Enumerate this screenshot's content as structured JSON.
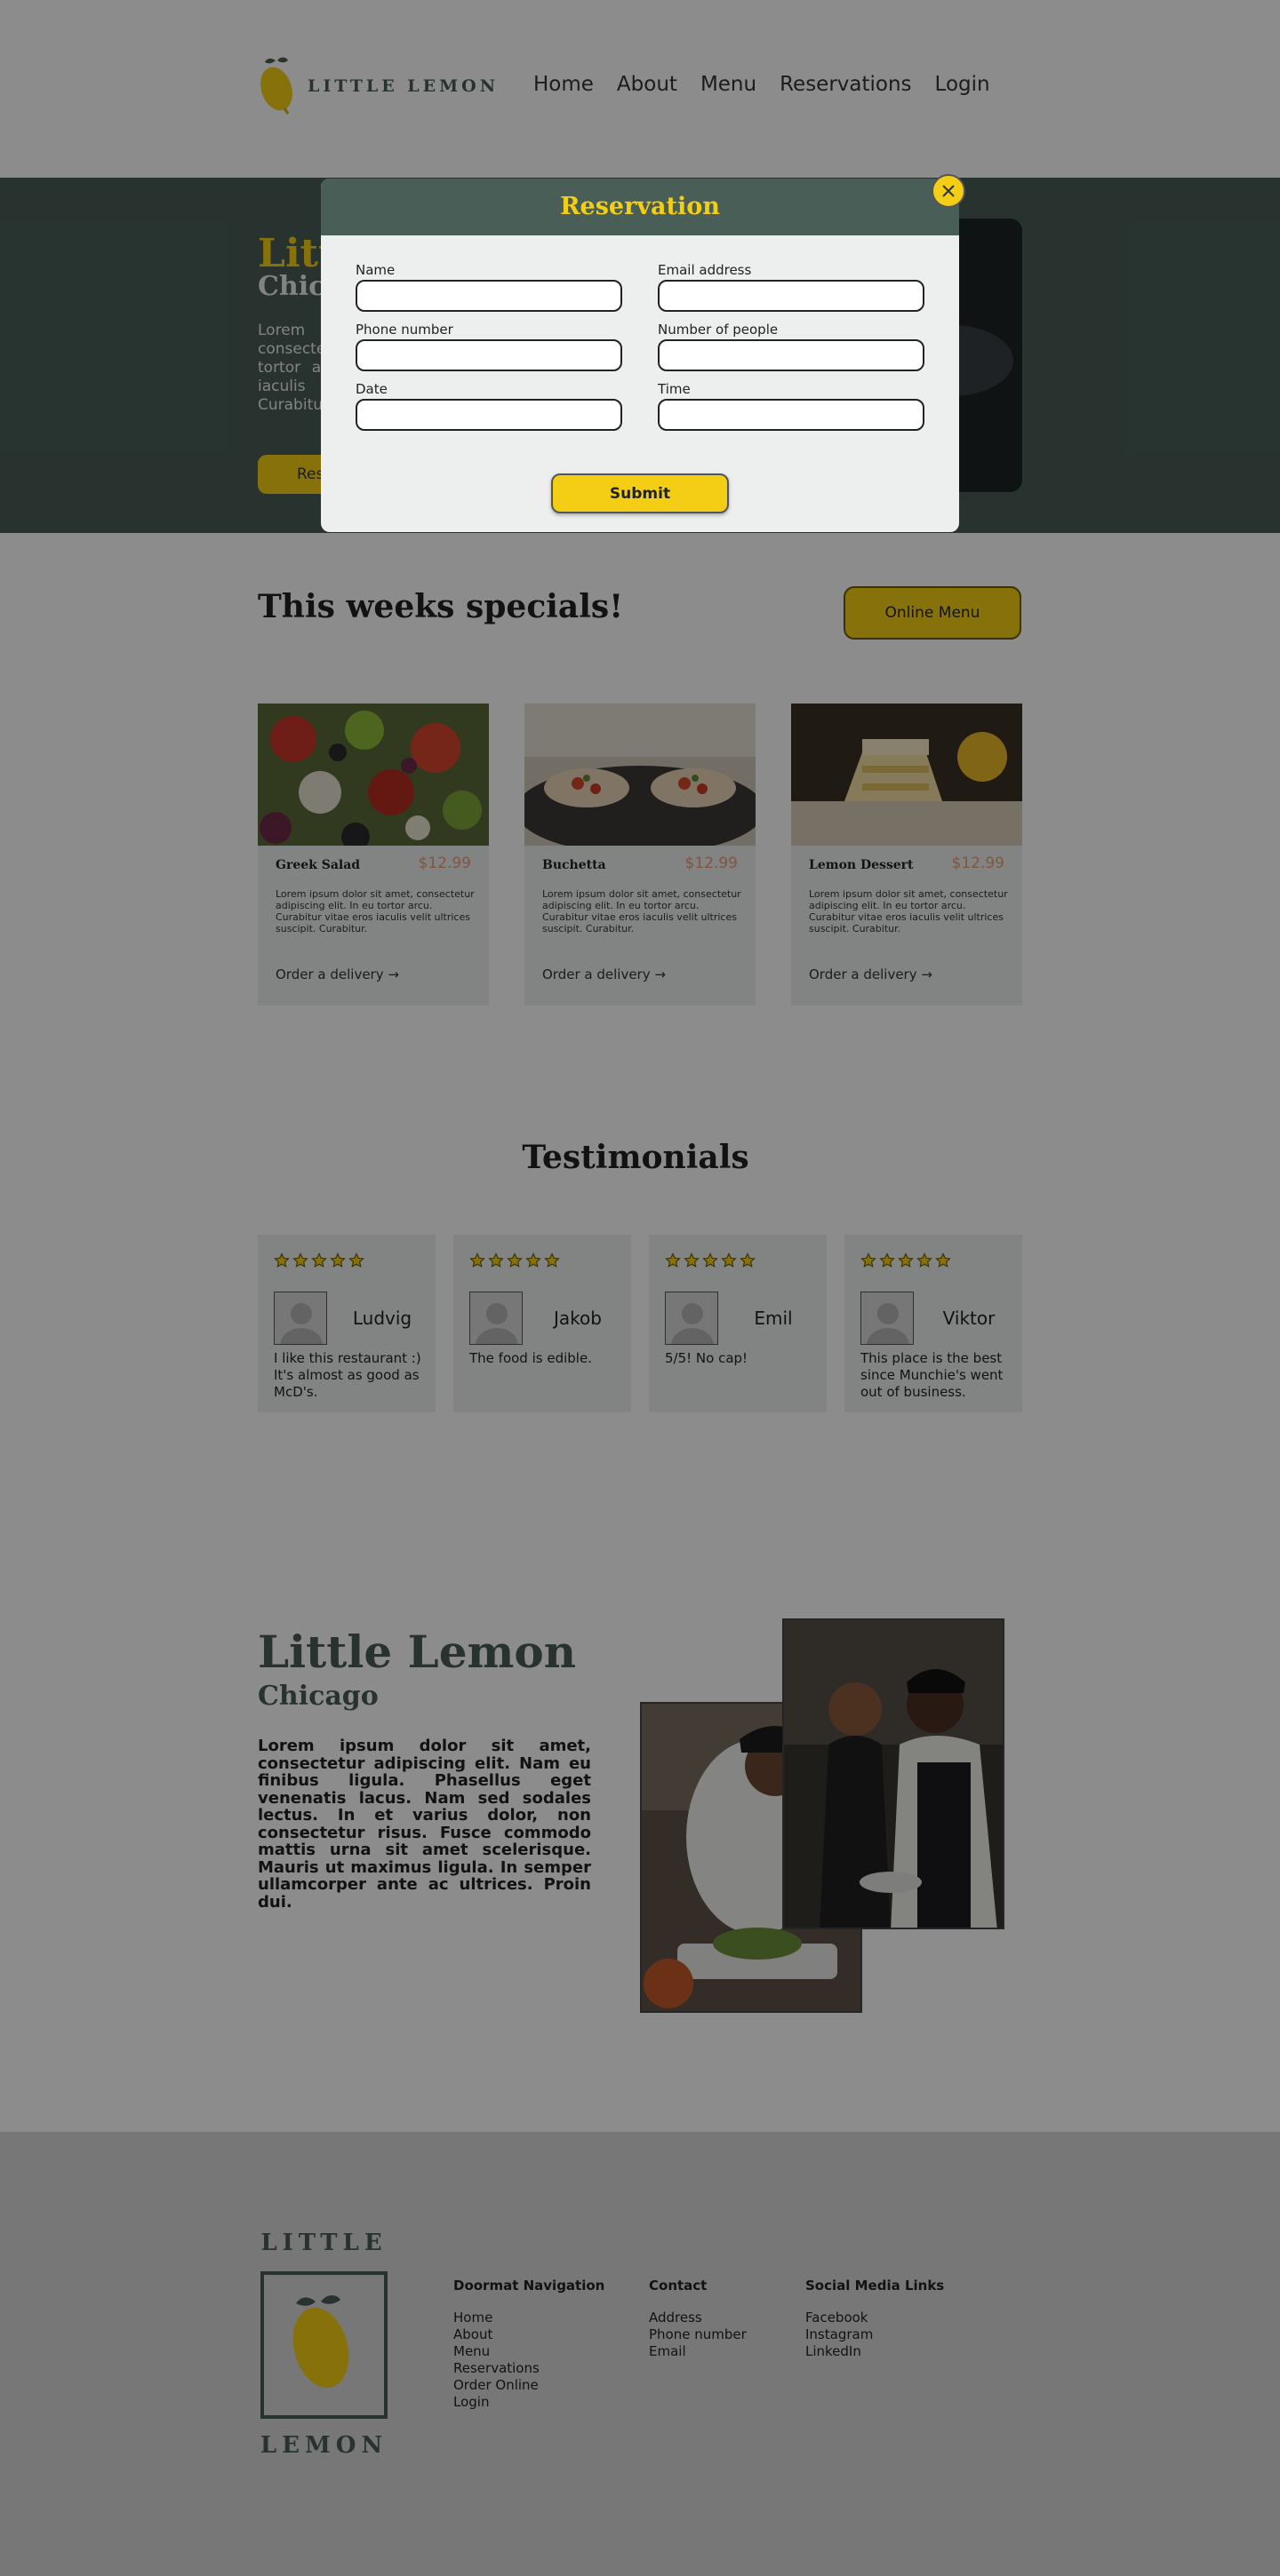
{
  "header": {
    "logo_text": "LITTLE LEMON",
    "nav": [
      "Home",
      "About",
      "Menu",
      "Reservations",
      "Login"
    ]
  },
  "hero": {
    "title": "Little Lemon",
    "subtitle": "Chicago",
    "text": "Lorem ipsum dolor sit amet, consectetur adipiscing elit. In eu tortor arcu. Curabitur vitae eros iaculis velit ultrices suscipit. Curabitur.",
    "button": "Reserve a table"
  },
  "specials": {
    "title": "This weeks specials!",
    "online_menu": "Online Menu",
    "cards": [
      {
        "name": "Greek Salad",
        "price": "$12.99",
        "desc": "Lorem ipsum dolor sit amet, consectetur adipiscing elit. In eu tortor arcu. Curabitur vitae eros iaculis velit ultrices suscipit. Curabitur.",
        "link": "Order a delivery →"
      },
      {
        "name": "Buchetta",
        "price": "$12.99",
        "desc": "Lorem ipsum dolor sit amet, consectetur adipiscing elit. In eu tortor arcu. Curabitur vitae eros iaculis velit ultrices suscipit. Curabitur.",
        "link": "Order a delivery →"
      },
      {
        "name": "Lemon Dessert",
        "price": "$12.99",
        "desc": "Lorem ipsum dolor sit amet, consectetur adipiscing elit. In eu tortor arcu. Curabitur vitae eros iaculis velit ultrices suscipit. Curabitur.",
        "link": "Order a delivery →"
      }
    ]
  },
  "testimonials": {
    "title": "Testimonials",
    "items": [
      {
        "name": "Ludvig",
        "quote": "I like this restaurant :) It's almost as good as McD's.",
        "rating": 5
      },
      {
        "name": "Jakob",
        "quote": "The food is edible.",
        "rating": 5
      },
      {
        "name": "Emil",
        "quote": "5/5! No cap!",
        "rating": 5
      },
      {
        "name": "Viktor",
        "quote": "This place is the best since Munchie's went out of business.",
        "rating": 5
      }
    ]
  },
  "about": {
    "title": "Little Lemon",
    "subtitle": "Chicago",
    "text": "Lorem ipsum dolor sit amet, consectetur adipiscing elit. Nam eu finibus ligula. Phasellus eget venenatis lacus. Nam sed sodales lectus. In et varius dolor, non consectetur risus. Fusce commodo mattis urna sit amet scelerisque. Mauris ut maximus ligula. In semper ullamcorper ante ac ultrices. Proin dui."
  },
  "footer": {
    "logo_top": "LITTLE",
    "logo_bottom": "LEMON",
    "columns": [
      {
        "heading": "Doormat Navigation",
        "links": [
          "Home",
          "About",
          "Menu",
          "Reservations",
          "Order Online",
          "Login"
        ]
      },
      {
        "heading": "Contact",
        "links": [
          "Address",
          "Phone number",
          "Email"
        ]
      },
      {
        "heading": "Social Media Links",
        "links": [
          "Facebook",
          "Instagram",
          "LinkedIn"
        ]
      }
    ]
  },
  "modal": {
    "title": "Reservation",
    "fields": {
      "name": {
        "label": "Name",
        "value": ""
      },
      "email": {
        "label": "Email address",
        "value": ""
      },
      "phone": {
        "label": "Phone number",
        "value": ""
      },
      "people": {
        "label": "Number of people",
        "value": ""
      },
      "date": {
        "label": "Date",
        "value": ""
      },
      "time": {
        "label": "Time",
        "value": ""
      }
    },
    "submit": "Submit",
    "close_icon": "close-icon"
  },
  "colors": {
    "primary_green": "#495e57",
    "primary_yellow": "#f4ce14",
    "highlight_light": "#edefee",
    "price_orange": "#ee9972",
    "footer_bg": "#d9d9d9"
  }
}
